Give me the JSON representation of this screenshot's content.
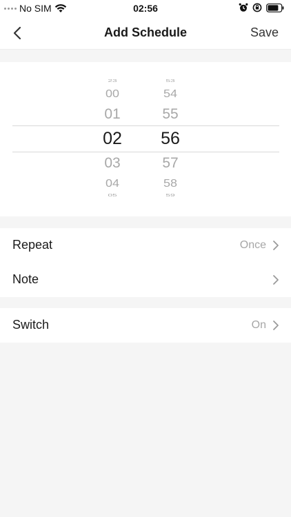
{
  "status_bar": {
    "carrier": "No SIM",
    "time": "02:56",
    "icons": [
      "signal-dots-icon",
      "wifi-icon",
      "alarm-icon",
      "orientation-lock-icon",
      "battery-icon"
    ]
  },
  "nav": {
    "title": "Add Schedule",
    "save_label": "Save",
    "back_icon": "chevron-left-icon"
  },
  "picker": {
    "hours": [
      "23",
      "00",
      "01",
      "02",
      "03",
      "04",
      "05"
    ],
    "minutes": [
      "53",
      "54",
      "55",
      "56",
      "57",
      "58",
      "59"
    ],
    "selected_hour": "02",
    "selected_minute": "56"
  },
  "settings": {
    "repeat": {
      "label": "Repeat",
      "value": "Once"
    },
    "note": {
      "label": "Note",
      "value": ""
    },
    "switch": {
      "label": "Switch",
      "value": "On"
    }
  },
  "colors": {
    "background": "#f5f5f5",
    "surface": "#ffffff",
    "text_primary": "#1a1a1a",
    "text_secondary": "#a6a6a6",
    "divider": "#d8d8d8"
  }
}
